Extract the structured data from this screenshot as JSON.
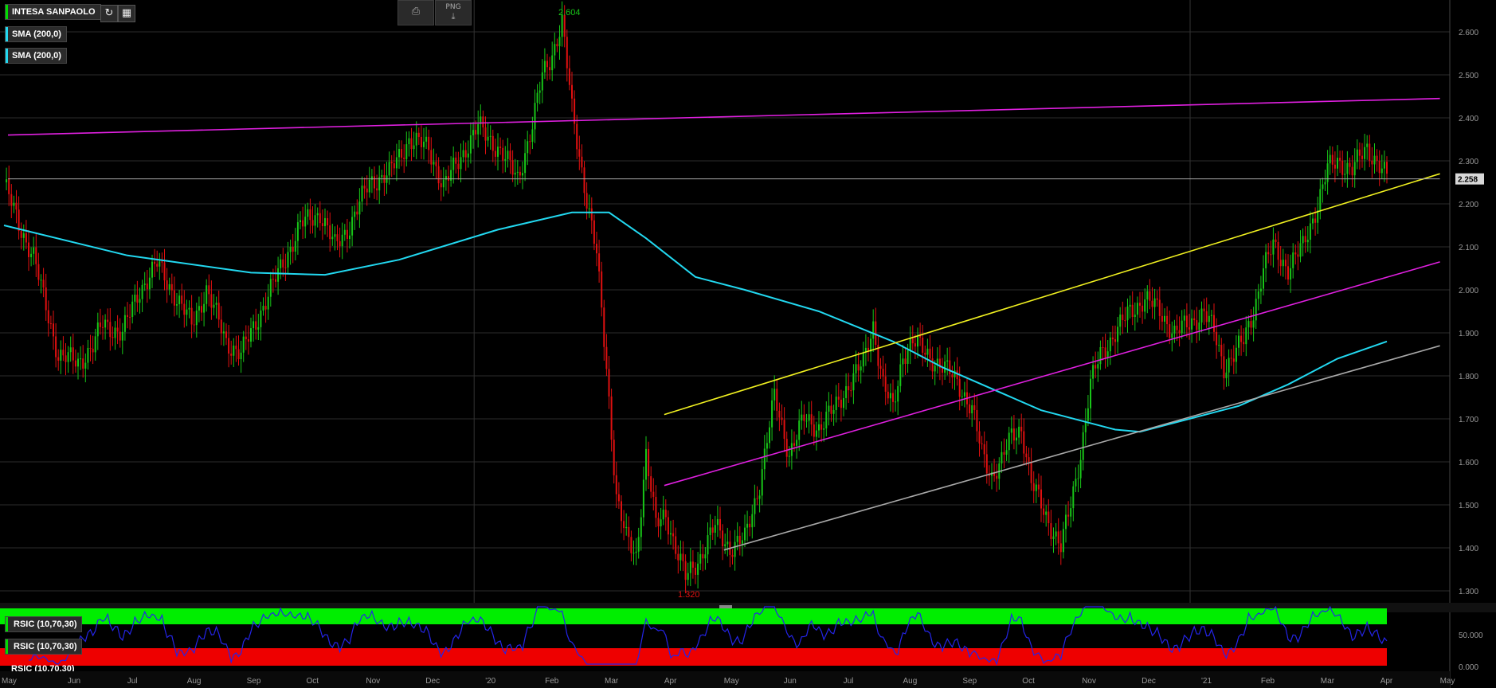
{
  "header": {
    "symbol": "INTESA SANPAOLO",
    "indicators": [
      "SMA (200,0)",
      "SMA (200,0)"
    ],
    "refresh_icon": "refresh-icon",
    "toolbar_icon": "calendar-icon",
    "print_icon": "print-icon",
    "png_label": "PNG"
  },
  "colors": {
    "up": "#18c518",
    "down": "#e01010",
    "sma": "#22d8f0",
    "magenta": "#e020e0",
    "yellow": "#f0f020",
    "gray": "#a8a8a8",
    "rsi_line": "#2424e8",
    "rsi_over": "#00ee00",
    "rsi_under": "#ee0000"
  },
  "chart_data": [
    {
      "type": "candlestick",
      "title": "INTESA SANPAOLO",
      "x_ticks": [
        "May",
        "Jun",
        "Jul",
        "Aug",
        "Sep",
        "Oct",
        "Nov",
        "Dec",
        "'20",
        "Feb",
        "Mar",
        "Apr",
        "May",
        "Jun",
        "Jul",
        "Aug",
        "Sep",
        "Oct",
        "Nov",
        "Dec",
        "'21",
        "Feb",
        "Mar",
        "Apr",
        "May"
      ],
      "y_ticks": [
        "1.300",
        "1.400",
        "1.500",
        "1.600",
        "1.700",
        "1.800",
        "1.900",
        "2.000",
        "2.100",
        "2.200",
        "2.300",
        "2.400",
        "2.500",
        "2.600"
      ],
      "ylim": [
        1.27,
        2.67
      ],
      "last_price": "2.258",
      "high_label": "2.604",
      "low_label": "1.320",
      "close_anchors": [
        [
          0,
          2.25
        ],
        [
          6,
          2.15
        ],
        [
          12,
          2.08
        ],
        [
          16,
          1.98
        ],
        [
          22,
          1.85
        ],
        [
          30,
          1.83
        ],
        [
          36,
          1.87
        ],
        [
          40,
          1.92
        ],
        [
          48,
          1.9
        ],
        [
          55,
          2.0
        ],
        [
          62,
          2.06
        ],
        [
          70,
          1.98
        ],
        [
          76,
          1.92
        ],
        [
          82,
          2.0
        ],
        [
          90,
          1.88
        ],
        [
          96,
          1.85
        ],
        [
          104,
          1.95
        ],
        [
          112,
          2.05
        ],
        [
          120,
          2.15
        ],
        [
          128,
          2.18
        ],
        [
          134,
          2.1
        ],
        [
          140,
          2.15
        ],
        [
          148,
          2.25
        ],
        [
          156,
          2.27
        ],
        [
          164,
          2.35
        ],
        [
          172,
          2.33
        ],
        [
          178,
          2.24
        ],
        [
          184,
          2.3
        ],
        [
          192,
          2.38
        ],
        [
          200,
          2.33
        ],
        [
          208,
          2.26
        ],
        [
          214,
          2.38
        ],
        [
          218,
          2.5
        ],
        [
          222,
          2.55
        ],
        [
          226,
          2.62
        ],
        [
          230,
          2.42
        ],
        [
          236,
          2.21
        ],
        [
          240,
          2.08
        ],
        [
          244,
          1.82
        ],
        [
          248,
          1.52
        ],
        [
          252,
          1.42
        ],
        [
          256,
          1.38
        ],
        [
          260,
          1.62
        ],
        [
          264,
          1.45
        ],
        [
          268,
          1.48
        ],
        [
          272,
          1.4
        ],
        [
          276,
          1.33
        ],
        [
          282,
          1.38
        ],
        [
          288,
          1.45
        ],
        [
          294,
          1.4
        ],
        [
          300,
          1.42
        ],
        [
          306,
          1.55
        ],
        [
          312,
          1.75
        ],
        [
          318,
          1.62
        ],
        [
          324,
          1.7
        ],
        [
          330,
          1.68
        ],
        [
          336,
          1.72
        ],
        [
          342,
          1.78
        ],
        [
          348,
          1.83
        ],
        [
          352,
          1.92
        ],
        [
          356,
          1.78
        ],
        [
          360,
          1.72
        ],
        [
          364,
          1.85
        ],
        [
          368,
          1.88
        ],
        [
          374,
          1.85
        ],
        [
          380,
          1.82
        ],
        [
          386,
          1.79
        ],
        [
          392,
          1.72
        ],
        [
          396,
          1.62
        ],
        [
          400,
          1.57
        ],
        [
          404,
          1.6
        ],
        [
          408,
          1.66
        ],
        [
          412,
          1.68
        ],
        [
          416,
          1.55
        ],
        [
          420,
          1.5
        ],
        [
          424,
          1.45
        ],
        [
          428,
          1.4
        ],
        [
          432,
          1.5
        ],
        [
          436,
          1.62
        ],
        [
          440,
          1.78
        ],
        [
          444,
          1.85
        ],
        [
          450,
          1.9
        ],
        [
          456,
          1.95
        ],
        [
          462,
          1.98
        ],
        [
          468,
          1.95
        ],
        [
          474,
          1.9
        ],
        [
          480,
          1.92
        ],
        [
          486,
          1.95
        ],
        [
          490,
          1.9
        ],
        [
          494,
          1.82
        ],
        [
          498,
          1.85
        ],
        [
          502,
          1.88
        ],
        [
          506,
          1.95
        ],
        [
          510,
          2.05
        ],
        [
          514,
          2.1
        ],
        [
          520,
          2.05
        ],
        [
          526,
          2.1
        ],
        [
          532,
          2.2
        ],
        [
          536,
          2.28
        ],
        [
          540,
          2.3
        ],
        [
          546,
          2.28
        ],
        [
          552,
          2.33
        ],
        [
          556,
          2.3
        ],
        [
          560,
          2.26
        ]
      ],
      "sma_points": [
        [
          0,
          2.15
        ],
        [
          50,
          2.08
        ],
        [
          100,
          2.04
        ],
        [
          130,
          2.035
        ],
        [
          160,
          2.07
        ],
        [
          200,
          2.14
        ],
        [
          230,
          2.18
        ],
        [
          245,
          2.18
        ],
        [
          260,
          2.12
        ],
        [
          280,
          2.03
        ],
        [
          300,
          2.0
        ],
        [
          330,
          1.95
        ],
        [
          360,
          1.88
        ],
        [
          380,
          1.82
        ],
        [
          420,
          1.72
        ],
        [
          450,
          1.675
        ],
        [
          460,
          1.67
        ],
        [
          480,
          1.7
        ],
        [
          500,
          1.73
        ],
        [
          520,
          1.78
        ],
        [
          540,
          1.84
        ],
        [
          560,
          1.88
        ]
      ],
      "trendlines": [
        {
          "name": "upper-magenta",
          "color": "magenta",
          "from": [
            "2019-05",
            2.36
          ],
          "to": [
            "2021-05",
            2.445
          ]
        },
        {
          "name": "yellow-channel",
          "color": "yellow",
          "from": [
            "2020-04",
            1.71
          ],
          "to": [
            "2021-05",
            2.27
          ]
        },
        {
          "name": "lower-magenta",
          "color": "magenta",
          "from": [
            "2020-04",
            1.545
          ],
          "to": [
            "2021-05",
            2.065
          ]
        },
        {
          "name": "gray-support",
          "color": "gray",
          "from": [
            "2020-05",
            1.395
          ],
          "to": [
            "2021-05",
            1.87
          ]
        },
        {
          "name": "price-level",
          "color": "gray",
          "from": [
            "2019-05",
            2.258
          ],
          "to": [
            "2021-05",
            2.258
          ]
        }
      ]
    },
    {
      "type": "line",
      "title": "RSIC (10,70,30)",
      "series_labels": [
        "RSIC (10,70,30)",
        "RSIC (10,70,30)",
        "RSIC (10,70,30)"
      ],
      "y_ticks": [
        "50.000",
        "0.000"
      ],
      "overbought": 70,
      "oversold": 30
    }
  ]
}
